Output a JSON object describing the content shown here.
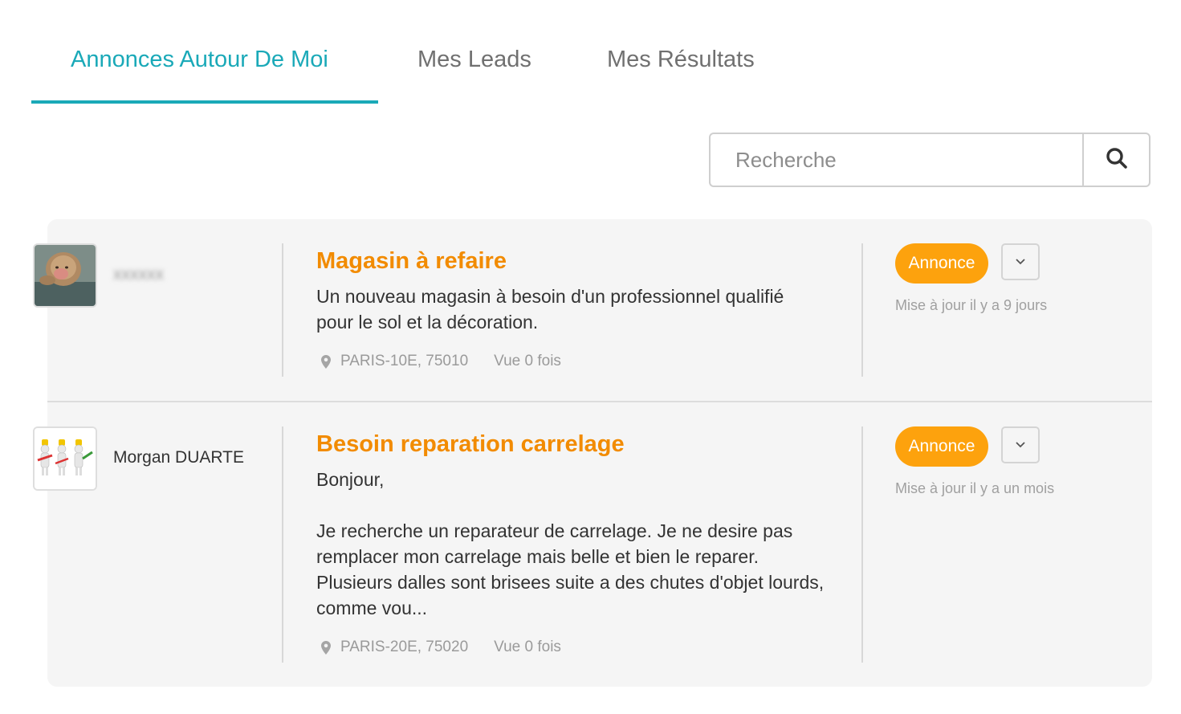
{
  "tabs": {
    "items": [
      {
        "label": "Annonces Autour De Moi",
        "active": true
      },
      {
        "label": "Mes Leads",
        "active": false
      },
      {
        "label": "Mes Résultats",
        "active": false
      }
    ]
  },
  "search": {
    "placeholder": "Recherche",
    "button_icon": "search-icon"
  },
  "listings": [
    {
      "author": "xxxxxx",
      "author_obscured": true,
      "avatar": "monkey-photo",
      "title": "Magasin à refaire",
      "description": "Un nouveau magasin à besoin d'un professionnel qualifié\npour le sol et la décoration.",
      "location": "PARIS-10E, 75010",
      "views": "Vue 0 fois",
      "badge": "Annonce",
      "updated": "Mise à jour il y a 9 jours"
    },
    {
      "author": "Morgan DUARTE",
      "author_obscured": false,
      "avatar": "workers-figurines",
      "title": "Besoin reparation carrelage",
      "description": "Bonjour,\n\nJe recherche un reparateur de carrelage. Je ne desire pas\nremplacer mon carrelage mais belle et bien le reparer.\nPlusieurs dalles sont brisees suite a des chutes d'objet lourds,\ncomme vou...",
      "location": "PARIS-20E, 75020",
      "views": "Vue 0 fois",
      "badge": "Annonce",
      "updated": "Mise à jour il y a un mois"
    }
  ],
  "colors": {
    "accent": "#1aa9b8",
    "title": "#f28b00",
    "badge": "#fda20d"
  }
}
